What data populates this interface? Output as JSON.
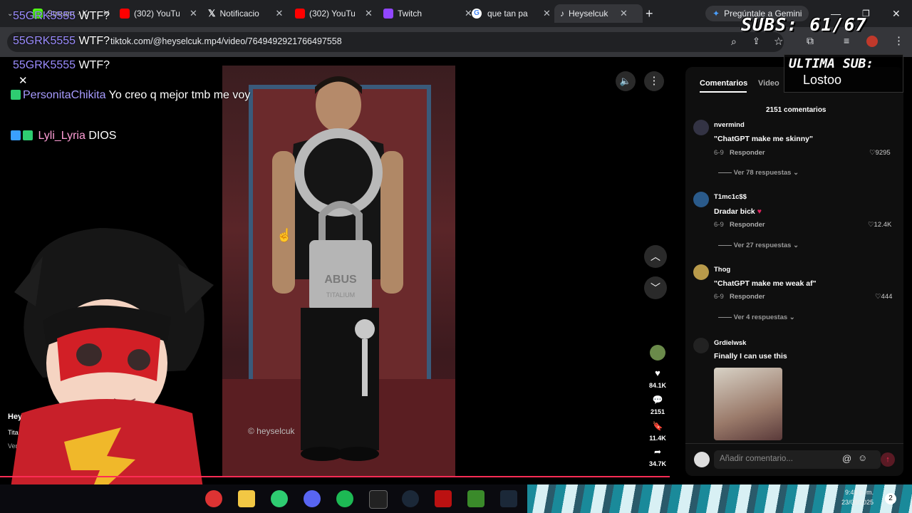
{
  "browser": {
    "tabs": [
      {
        "label": "Stream · K",
        "color": "#53fc18",
        "icon": "kick-icon"
      },
      {
        "label": "(302) YouTu",
        "color": "#ff0000",
        "icon": "youtube-icon"
      },
      {
        "label": "Notificacio",
        "color": "#ffffff",
        "icon": "x-icon"
      },
      {
        "label": "(302) YouTu",
        "color": "#ff0000",
        "icon": "youtube-icon"
      },
      {
        "label": "Twitch",
        "color": "#9146ff",
        "icon": "twitch-icon"
      },
      {
        "label": "que tan pa",
        "color": "#4285f4",
        "icon": "google-icon"
      },
      {
        "label": "Heyselcuk",
        "color": "#ffffff",
        "icon": "tiktok-icon"
      }
    ],
    "new_tab": "+",
    "gemini": "Pregúntale a Gemini",
    "url": "tiktok.com/@heyselcuk.mp4/video/7649492921766497558"
  },
  "chat": {
    "lines": [
      {
        "user": "55GRK5555",
        "msg": "WTF?"
      },
      {
        "user": "55GRK5555",
        "msg": "WTF?"
      },
      {
        "user": "55GRK5555",
        "msg": "WTF?"
      },
      {
        "user": "PersonitaChikita",
        "msg": "Yo creo q mejor tmb me voy"
      },
      {
        "user": "Lyli_Lyria",
        "msg": "DIOS"
      }
    ]
  },
  "overlay": {
    "subs": "SUBS: 61/67",
    "last_sub_label": "ULTIMA SUB:",
    "last_sub_name": "Lostoo"
  },
  "video": {
    "watermark": "© heyselcuk",
    "lock_text": "ABUS",
    "lock_sub": "TITALIUM",
    "truncated_side": [
      "Heys",
      "Tita",
      "Ver"
    ],
    "stats": {
      "likes": "84.1K",
      "comments": "2151",
      "saves": "11.4K",
      "shares": "34.7K"
    }
  },
  "panel": {
    "tab_comments": "Comentarios",
    "tab_videos": "Video",
    "count": "2151 comentarios",
    "comments": [
      {
        "user": "nvermind",
        "text": "\"ChatGPT make me skinny\"",
        "date": "6-9",
        "reply": "Responder",
        "likes": "9295",
        "more": "Ver 78 respuestas"
      },
      {
        "user": "T1mc1c$$",
        "text": "Dradar bick",
        "date": "6-9",
        "reply": "Responder",
        "likes": "12.4K",
        "more": "Ver 27 respuestas"
      },
      {
        "user": "Thog",
        "text": "\"ChatGPT make me weak af\"",
        "date": "6-9",
        "reply": "Responder",
        "likes": "444",
        "more": "Ver 4 respuestas"
      },
      {
        "user": "Grdielwsk",
        "text": "Finally I can use this"
      }
    ],
    "input_placeholder": "Añadir comentario..."
  },
  "taskbar": {
    "time": "9:48 p. m.",
    "date": "23/08/2025",
    "notif_count": "2"
  },
  "colors": {
    "accent_red": "#fe2c55",
    "chat_user": "#9b8cff"
  }
}
